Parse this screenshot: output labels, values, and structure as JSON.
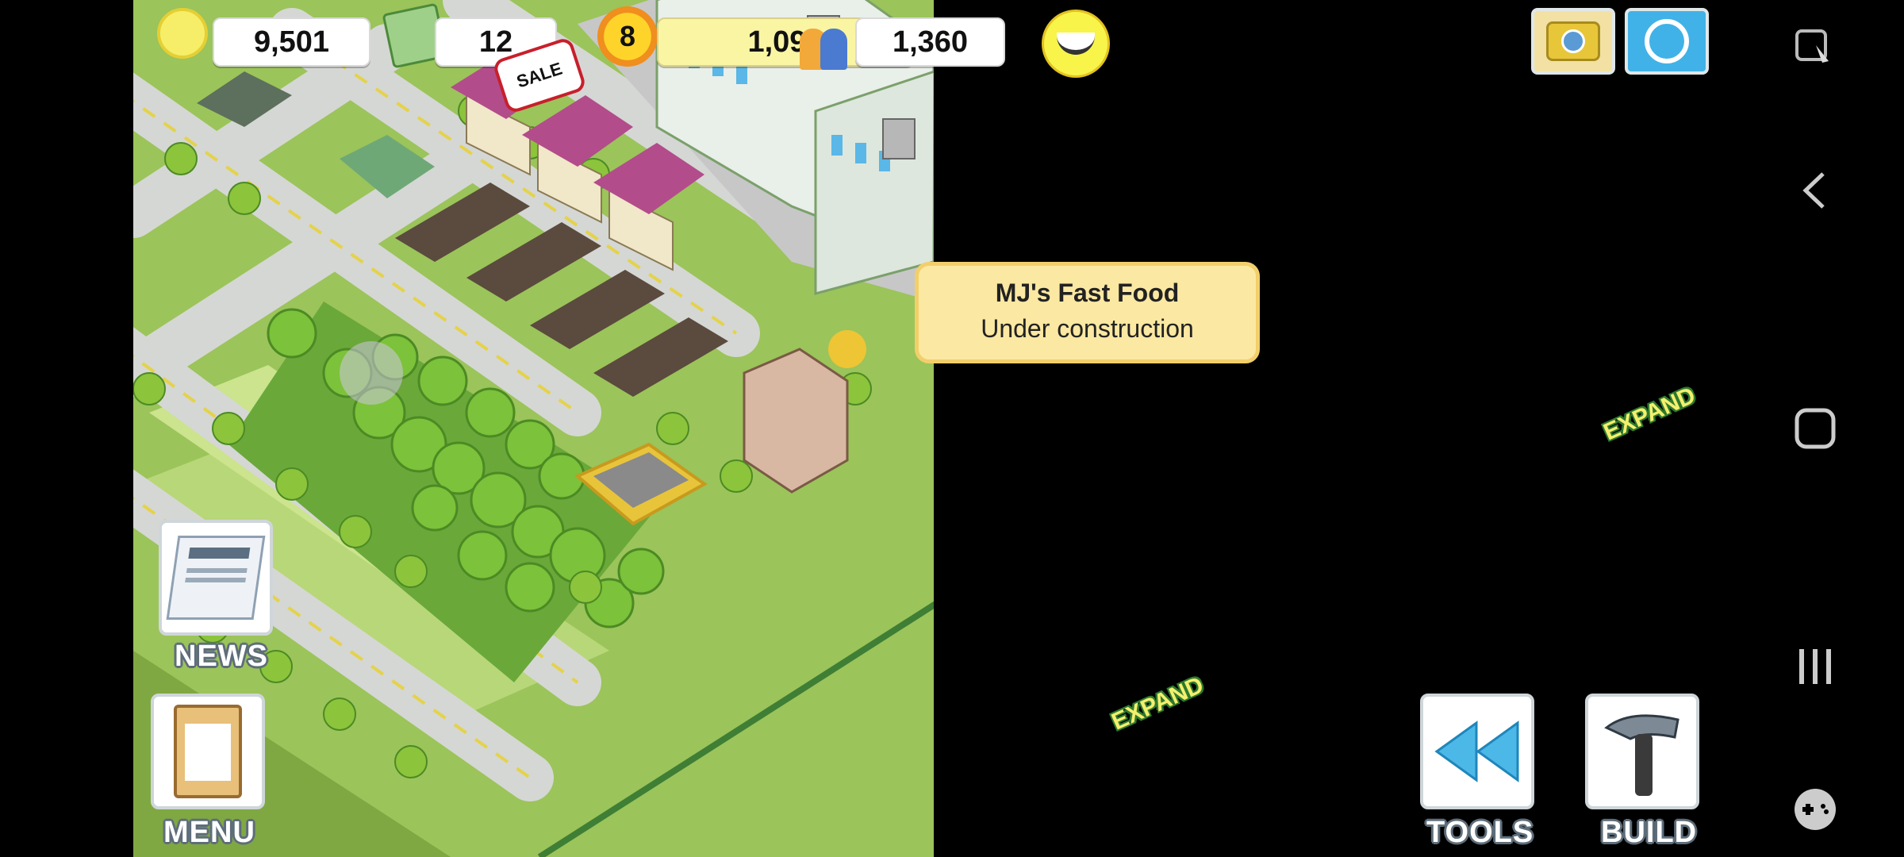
{
  "hud": {
    "coins": "9,501",
    "cash": "12",
    "level": "8",
    "xp": "1,092",
    "population": "1,360",
    "sale_badge": "SALE"
  },
  "tooltip": {
    "title": "MJ's Fast Food",
    "subtitle": "Under construction"
  },
  "expand_labels": [
    "EXPAND",
    "EXPAND"
  ],
  "side_menu": {
    "news": "NEWS",
    "menu": "MENU",
    "tools": "TOOLS",
    "build": "BUILD"
  },
  "colors": {
    "grass": "#9bc45a",
    "road": "#d8d8d8",
    "tooltip_bg": "#fbe8a2",
    "accent_yellow": "#f4ef2e"
  }
}
